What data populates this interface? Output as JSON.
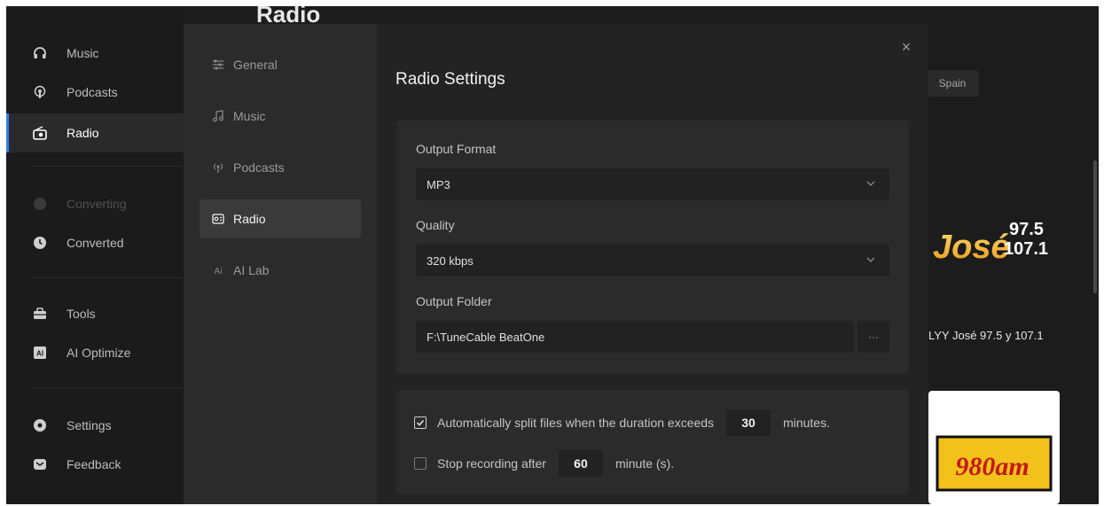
{
  "sidebar": {
    "items": [
      {
        "label": "Music",
        "icon": "headphones-icon"
      },
      {
        "label": "Podcasts",
        "icon": "podcast-icon"
      },
      {
        "label": "Radio",
        "icon": "radio-icon"
      },
      {
        "label": "Converting",
        "icon": "converting-icon"
      },
      {
        "label": "Converted",
        "icon": "clock-icon"
      },
      {
        "label": "Tools",
        "icon": "toolbox-icon"
      },
      {
        "label": "AI Optimize",
        "icon": "ai-icon"
      },
      {
        "label": "Settings",
        "icon": "gear-icon"
      },
      {
        "label": "Feedback",
        "icon": "mail-icon"
      }
    ],
    "active": "Radio",
    "accent": "#2f80ed"
  },
  "page": {
    "title": "Radio",
    "chip": "Spain",
    "station_name": "LYY José 97.5 y 107.1",
    "logo_text": "José",
    "logo_freq_top": "97.5",
    "logo_freq_bottom": "107.1",
    "logo2_text": "980am"
  },
  "dialog": {
    "nav": [
      {
        "label": "General",
        "icon": "sliders-icon"
      },
      {
        "label": "Music",
        "icon": "music-note-icon"
      },
      {
        "label": "Podcasts",
        "icon": "broadcast-icon"
      },
      {
        "label": "Radio",
        "icon": "radio-box-icon"
      },
      {
        "label": "AI Lab",
        "icon": "ai-lab-icon"
      }
    ],
    "active": "Radio",
    "title": "Radio Settings",
    "close": "×",
    "output_format_label": "Output Format",
    "output_format_value": "MP3",
    "quality_label": "Quality",
    "quality_value": "320 kbps",
    "output_folder_label": "Output Folder",
    "output_folder_value": "F:\\TuneCable BeatOne",
    "browse_label": "···",
    "split": {
      "checked": true,
      "text": "Automatically split files when the duration exceeds",
      "value": "30",
      "unit": "minutes."
    },
    "stop": {
      "checked": false,
      "text": "Stop recording after",
      "value": "60",
      "unit": "minute (s)."
    }
  }
}
